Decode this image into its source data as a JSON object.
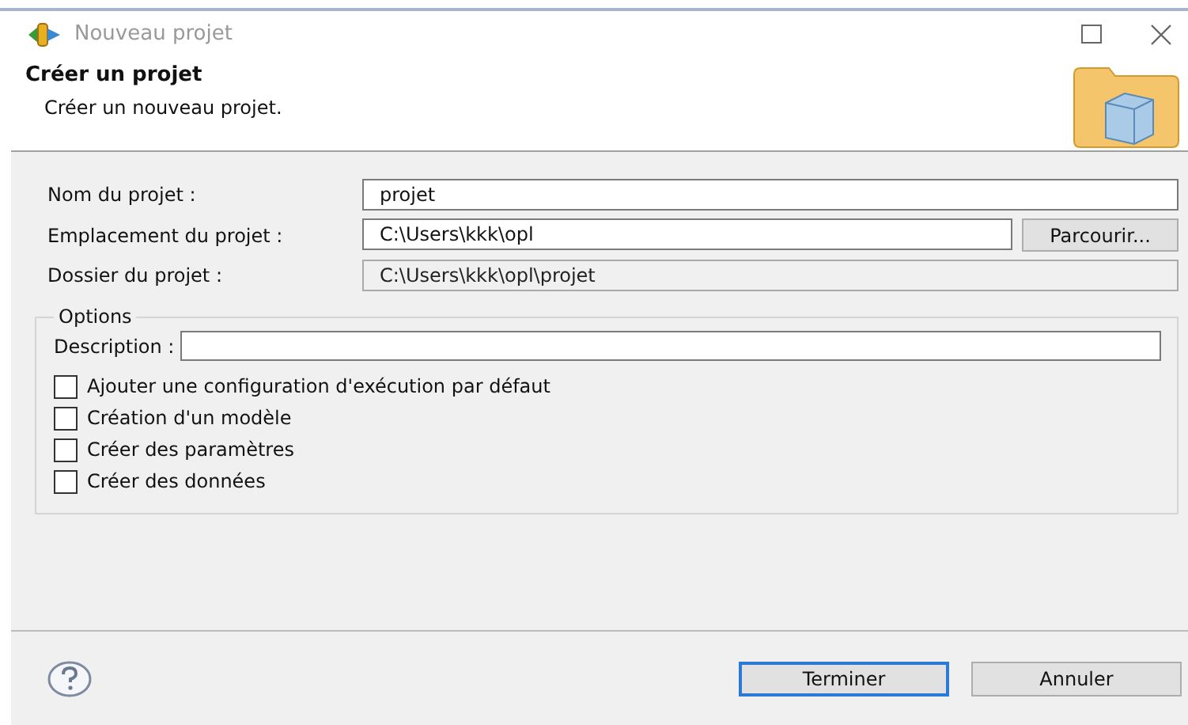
{
  "window": {
    "title": "Nouveau projet"
  },
  "header": {
    "title": "Créer un projet",
    "subtitle": "Créer un nouveau projet."
  },
  "fields": [
    {
      "label": "Nom du projet :",
      "value": "projet",
      "disabled": false
    },
    {
      "label": "Emplacement du projet :",
      "value": "C:\\Users\\kkk\\opl",
      "disabled": false,
      "button": "Parcourir..."
    },
    {
      "label": "Dossier du projet :",
      "value": "C:\\Users\\kkk\\opl\\projet",
      "disabled": true
    }
  ],
  "options": {
    "title": "Options",
    "description_label": "Description :",
    "checkboxes": [
      {
        "label": "Ajouter une configuration d'exécution par défaut",
        "checked": false
      },
      {
        "label": "Création d'un modèle",
        "checked": false
      },
      {
        "label": "Créer des paramètres",
        "checked": false
      },
      {
        "label": "Créer des données",
        "checked": false
      }
    ]
  },
  "buttons": [
    {
      "label": "Terminer",
      "default": true
    },
    {
      "label": "Annuler",
      "default": false
    }
  ]
}
